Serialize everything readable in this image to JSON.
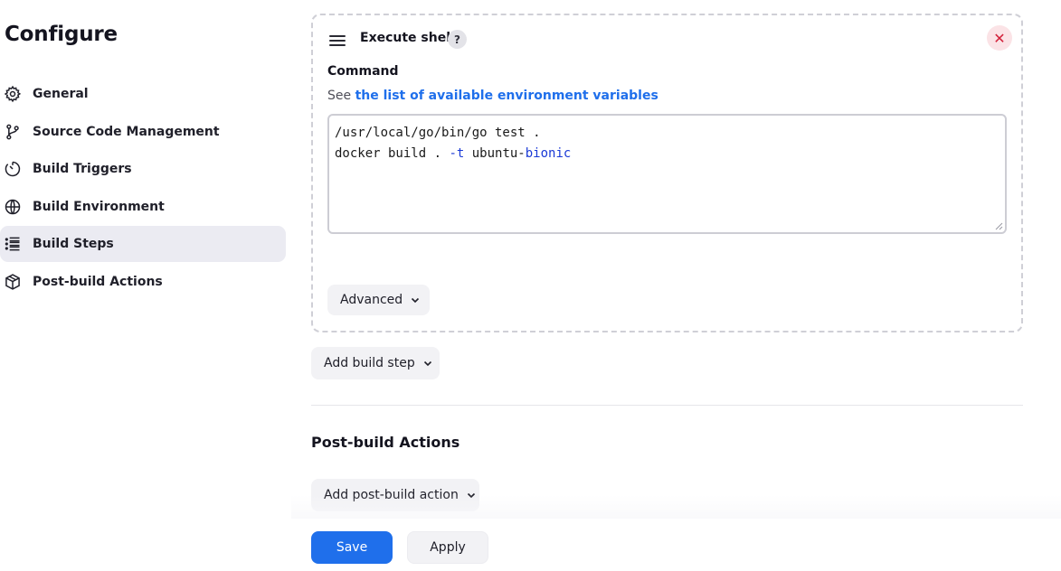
{
  "page": {
    "title": "Configure"
  },
  "sidebar": {
    "items": [
      {
        "label": "General",
        "icon": "gear-icon"
      },
      {
        "label": "Source Code Management",
        "icon": "branch-icon"
      },
      {
        "label": "Build Triggers",
        "icon": "timer-icon"
      },
      {
        "label": "Build Environment",
        "icon": "globe-icon"
      },
      {
        "label": "Build Steps",
        "icon": "list-icon",
        "active": true
      },
      {
        "label": "Post-build Actions",
        "icon": "package-icon"
      }
    ]
  },
  "step": {
    "title": "Execute shell",
    "help": "?",
    "close": "✕",
    "command_label": "Command",
    "env_prefix": "See",
    "env_link": "the list of available environment variables",
    "command_lines": {
      "line1": "/usr/local/go/bin/go test .",
      "line2_a": "docker build . ",
      "line2_flag": "-t",
      "line2_b": " ubuntu-",
      "line2_kw": "bionic"
    },
    "advanced_label": "Advanced"
  },
  "build_steps": {
    "add_label": "Add build step"
  },
  "post_build": {
    "title": "Post-build Actions",
    "add_label": "Add post-build action"
  },
  "footer": {
    "save_label": "Save",
    "apply_label": "Apply"
  },
  "colors": {
    "accent": "#1f6feb",
    "danger": "#d3213a",
    "active_nav_bg": "#ebebf2"
  }
}
